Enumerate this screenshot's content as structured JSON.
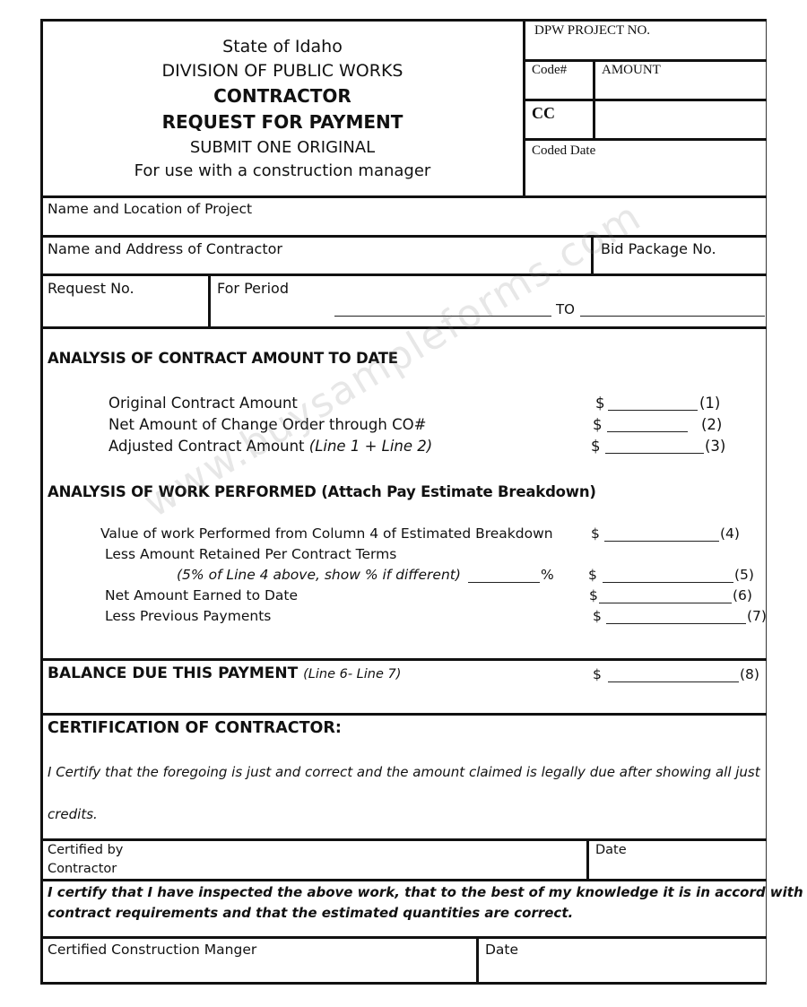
{
  "header": {
    "state": "State of Idaho",
    "division": "DIVISION OF PUBLIC WORKS",
    "title_line1": "CONTRACTOR",
    "title_line2": "REQUEST FOR PAYMENT",
    "submit_note": "SUBMIT ONE ORIGINAL",
    "usage_note": "For use with a construction manager"
  },
  "office_box": {
    "project_no_label": "DPW PROJECT NO.",
    "code_label": "Code#",
    "amount_label": "AMOUNT",
    "cc_label": "CC",
    "coded_date_label": "Coded Date"
  },
  "project_info": {
    "name_location_label": "Name and Location  of Project",
    "contractor_label": "Name and Address of Contractor",
    "bid_package_label": "Bid Package No.",
    "request_no_label": "Request No.",
    "for_period_label": "For Period",
    "to_label": "TO"
  },
  "contract_analysis": {
    "heading": "ANALYSIS OF CONTRACT AMOUNT TO DATE",
    "lines": [
      {
        "label": "Original Contract Amount",
        "note": "",
        "currency": "$",
        "number": "(1)"
      },
      {
        "label": "Net Amount of Change Order through CO#",
        "note": "",
        "currency": "$",
        "number": "(2)"
      },
      {
        "label": "Adjusted Contract Amount ",
        "note": "(Line 1 + Line 2)",
        "currency": "$",
        "number": "(3)"
      }
    ]
  },
  "work_analysis": {
    "heading": "ANALYSIS OF WORK PERFORMED (Attach Pay Estimate Breakdown)",
    "lines": [
      {
        "label": "Value of work Performed from Column 4 of Estimated Breakdown",
        "currency": "$",
        "number": "(4)"
      },
      {
        "label": "Less Amount Retained Per Contract Terms",
        "currency": "",
        "number": ""
      },
      {
        "label": "(5% of Line 4 above, show % if different)",
        "percent_sign": "%",
        "currency": "$",
        "number": "(5)"
      },
      {
        "label": "Net Amount Earned to Date",
        "currency": "$",
        "number": "(6)"
      },
      {
        "label": "Less Previous Payments",
        "currency": "$",
        "number": "(7)"
      }
    ]
  },
  "balance": {
    "label": "BALANCE DUE THIS PAYMENT ",
    "note": "(Line 6- Line 7)",
    "currency": "$",
    "number": "(8)"
  },
  "certification": {
    "heading": "CERTIFICATION OF CONTRACTOR:",
    "statement_line1": "I Certify that the foregoing is just and correct and the amount claimed is legally due after showing all just",
    "statement_line2": "credits.",
    "certified_by_line1": "Certified by",
    "certified_by_line2": "Contractor",
    "date_label": "Date",
    "manager_statement_line1": "I certify that I have inspected the above work, that to the best of my knowledge it is in accord with",
    "manager_statement_line2": "contract requirements and that the estimated quantities are correct.",
    "manager_label": "Certified Construction Manger",
    "manager_date_label": "Date"
  },
  "watermark": "www.buysampleforms.com"
}
